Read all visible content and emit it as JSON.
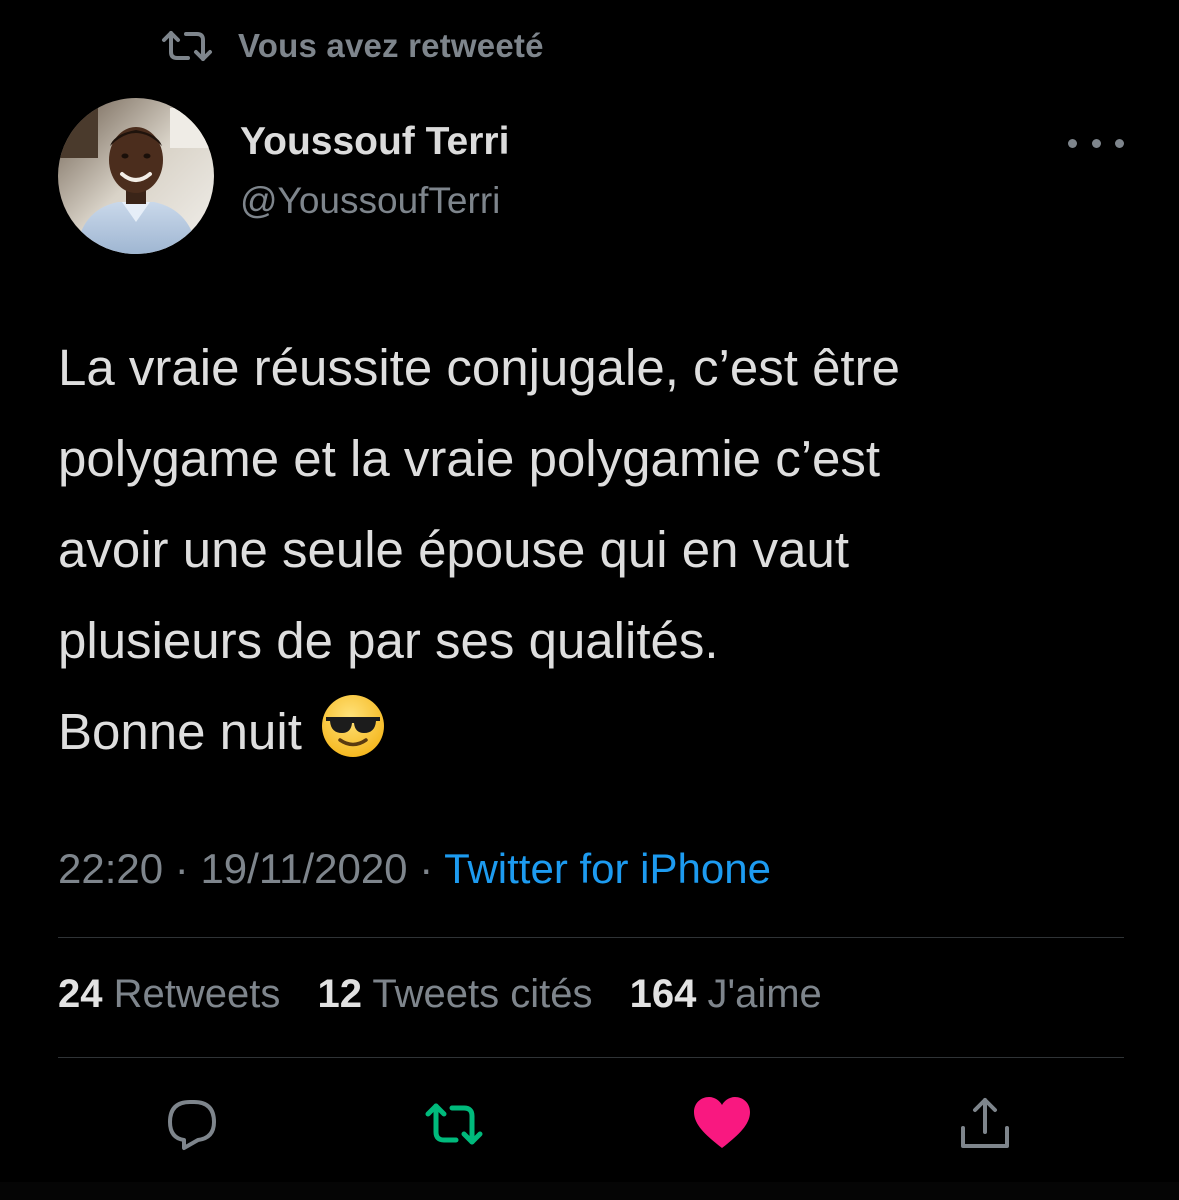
{
  "retweet_context": {
    "icon": "retweet-icon",
    "text": "Vous avez retweeté"
  },
  "author": {
    "name": "Youssouf Terri",
    "handle": "@YoussoufTerri",
    "avatar": "profile-photo"
  },
  "more_menu": {
    "icon": "more-horizontal-icon"
  },
  "tweet": {
    "lines": [
      "La vraie réussite conjugale, c’est être",
      "polygame et la vraie polygamie c’est",
      "avoir une seule épouse qui en vaut",
      "plusieurs de par ses qualités.",
      "Bonne nuit"
    ],
    "emoji": "smiling-face-with-sunglasses"
  },
  "meta": {
    "time": "22:20",
    "separator": "·",
    "date": "19/11/2020",
    "source": "Twitter for iPhone"
  },
  "stats": {
    "retweets": {
      "count": "24",
      "label": "Retweets"
    },
    "quotes": {
      "count": "12",
      "label": "Tweets cités"
    },
    "likes": {
      "count": "164",
      "label": "J'aime"
    }
  },
  "actions": {
    "reply": {
      "icon": "reply-icon"
    },
    "retweet": {
      "icon": "retweet-icon",
      "active": true,
      "color": "#00ba7c"
    },
    "like": {
      "icon": "heart-icon",
      "active": true,
      "color": "#f91880"
    },
    "share": {
      "icon": "share-icon"
    }
  },
  "colors": {
    "background": "#000000",
    "text": "#d9d9d9",
    "muted": "#7e858c",
    "link": "#1d9bf0",
    "divider": "#2f3336"
  }
}
